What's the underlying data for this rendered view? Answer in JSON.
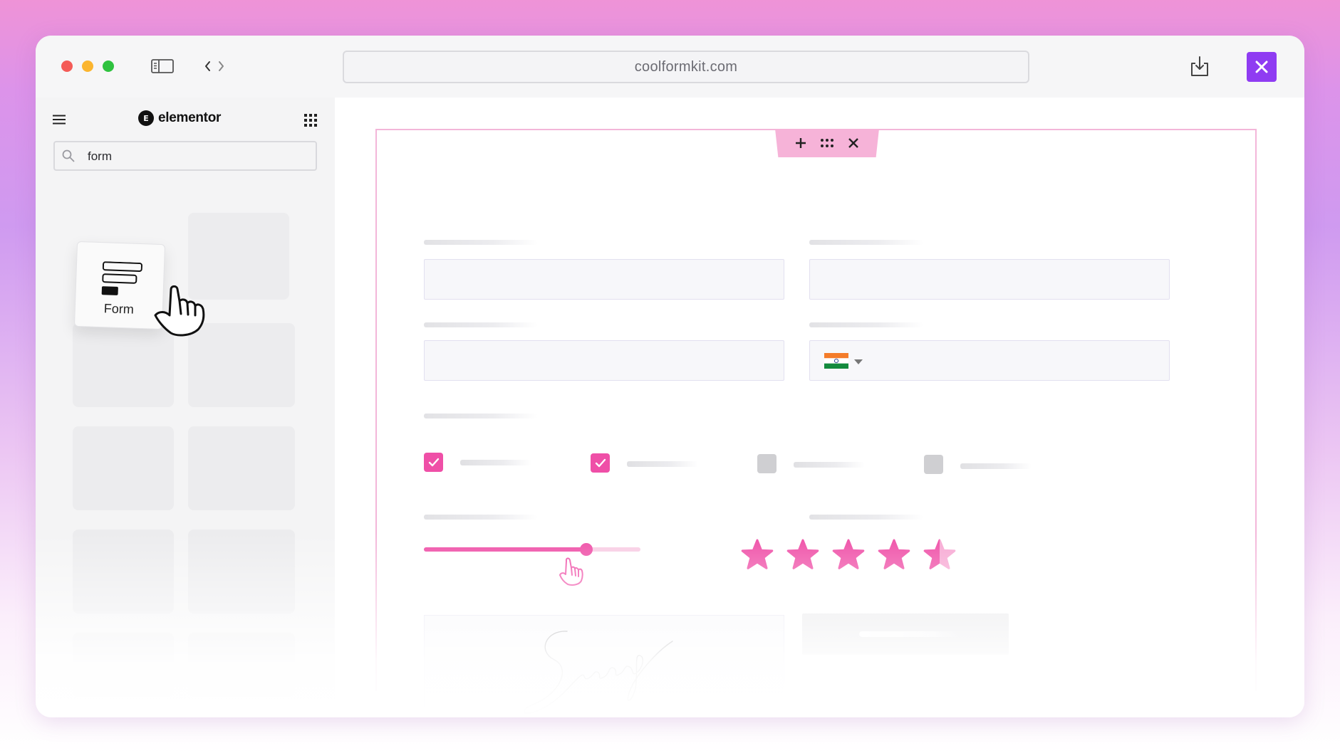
{
  "browser": {
    "url": "coolformkit.com"
  },
  "panel": {
    "brand_name": "elementor",
    "brand_logo_letter": "E",
    "search": {
      "value": "form",
      "placeholder": ""
    },
    "widget": {
      "label": "Form",
      "icon": "form-widget-icon"
    }
  },
  "canvas": {
    "phone_field": {
      "country_flag": "india-flag-icon"
    },
    "checkboxes": [
      {
        "checked": true
      },
      {
        "checked": true
      },
      {
        "checked": false
      },
      {
        "checked": false
      }
    ],
    "slider": {
      "value": 0.75
    },
    "rating": {
      "value": 4.5,
      "max": 5
    },
    "signature": {
      "kind": "handwritten-signature"
    }
  },
  "colors": {
    "accent": "#ef4fa7",
    "accent_light": "#f8cde4",
    "section_border": "#f3b6d9",
    "close_button": "#8f3cf2",
    "background_top": "#ef93d7",
    "background_mid": "#cf9af0"
  }
}
